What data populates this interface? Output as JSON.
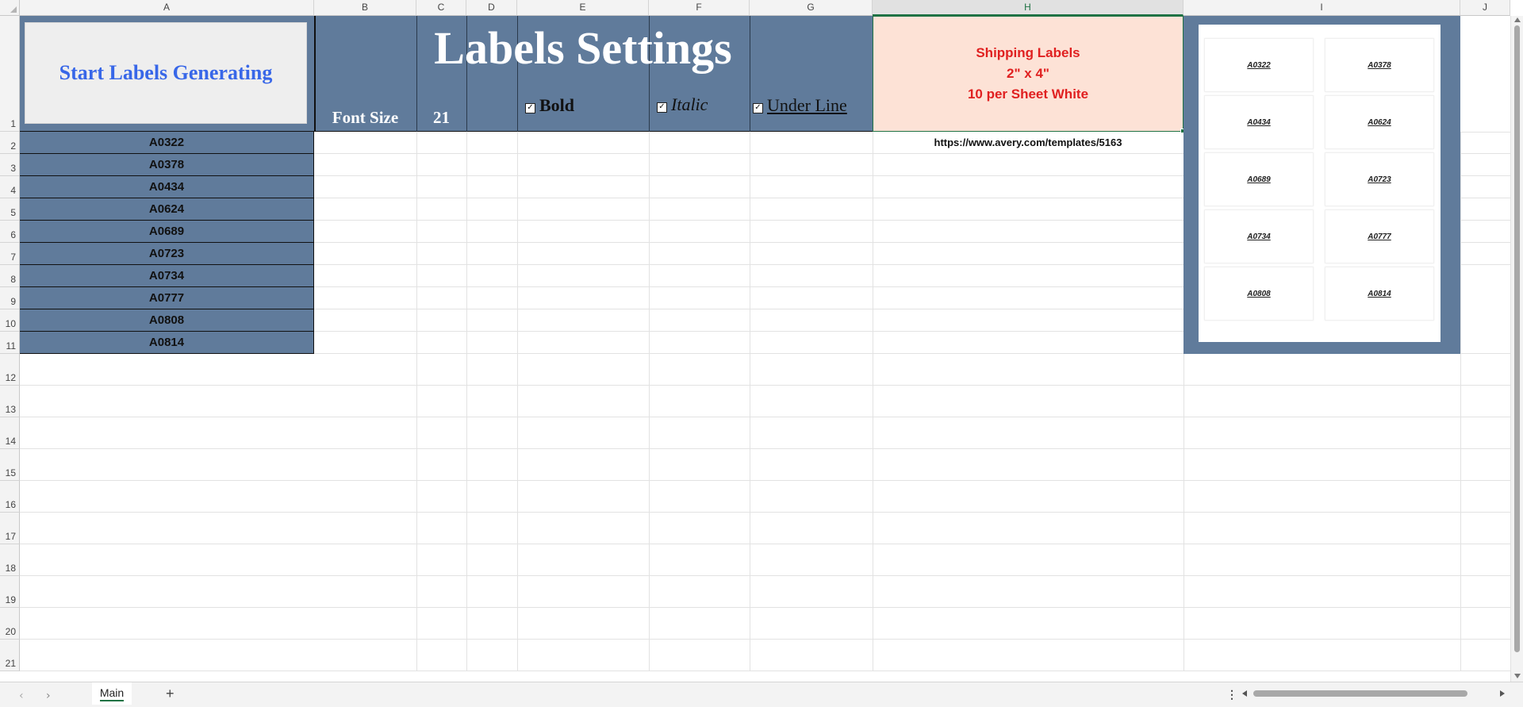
{
  "columns": [
    "A",
    "B",
    "C",
    "D",
    "E",
    "F",
    "G",
    "H",
    "I",
    "J"
  ],
  "rows": [
    "1",
    "2",
    "3",
    "4",
    "5",
    "6",
    "7",
    "8",
    "9",
    "10",
    "11",
    "12",
    "13",
    "14",
    "15",
    "16",
    "17",
    "18",
    "19",
    "20",
    "21"
  ],
  "header": {
    "button_label": "Start Labels Generating",
    "title": "Labels Settings",
    "font_size_label": "Font Size",
    "font_size_value": "21",
    "bold_label": "Bold",
    "italic_label": "Italic",
    "underline_label": "Under Line",
    "bold_checked": true,
    "italic_checked": true,
    "underline_checked": true
  },
  "shipping": {
    "line1": "Shipping Labels",
    "line2": "2\" x 4\"",
    "line3": "10 per Sheet White",
    "url": "https://www.avery.com/templates/5163"
  },
  "codes": [
    "A0322",
    "A0378",
    "A0434",
    "A0624",
    "A0689",
    "A0723",
    "A0734",
    "A0777",
    "A0808",
    "A0814"
  ],
  "preview_labels": [
    "A0322",
    "A0378",
    "A0434",
    "A0624",
    "A0689",
    "A0723",
    "A0734",
    "A0777",
    "A0808",
    "A0814"
  ],
  "sheet_tabs": [
    {
      "label": "Main",
      "active": true
    }
  ],
  "add_sheet_symbol": "+",
  "colors": {
    "header_blue": "#607b9b",
    "button_text": "#3867e8",
    "shipping_bg": "#fde2d6",
    "shipping_text": "#e02020",
    "selection_green": "#1f7244"
  }
}
